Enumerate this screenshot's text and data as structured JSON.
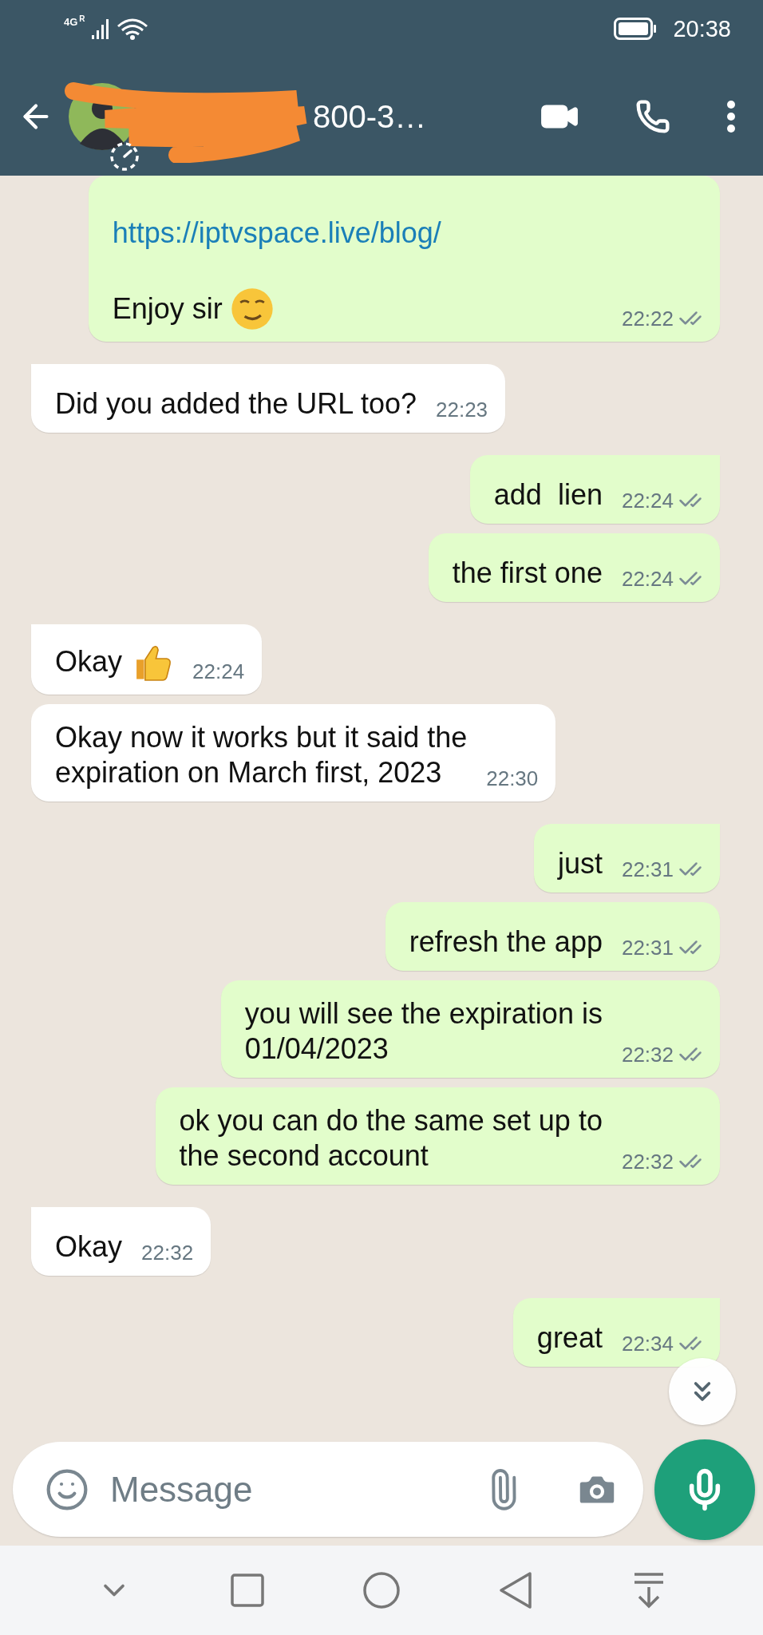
{
  "status_bar": {
    "network": "4G",
    "roaming": "R",
    "time": "20:38"
  },
  "header": {
    "contact_name": "800-3…"
  },
  "messages": [
    {
      "outgoing": true,
      "tail": false,
      "kind": "smile",
      "link": "https://iptvspace.live/blog/",
      "text": "Enjoy sir",
      "time": "22:22",
      "delivered": true
    },
    {
      "outgoing": false,
      "tail": true,
      "kind": "plain",
      "text": "Did you added the URL too?",
      "time": "22:23"
    },
    {
      "outgoing": true,
      "tail": true,
      "kind": "plain",
      "text": "add  lien",
      "time": "22:24",
      "delivered": true
    },
    {
      "outgoing": true,
      "tail": false,
      "kind": "plain",
      "text": "the first one",
      "time": "22:24",
      "delivered": true
    },
    {
      "outgoing": false,
      "tail": true,
      "kind": "thumbs",
      "text": "Okay",
      "time": "22:24"
    },
    {
      "outgoing": false,
      "tail": false,
      "kind": "plain",
      "text": "Okay now it works but it said the\nexpiration on March first, 2023",
      "time": "22:30"
    },
    {
      "outgoing": true,
      "tail": true,
      "kind": "plain",
      "text": "just",
      "time": "22:31",
      "delivered": true
    },
    {
      "outgoing": true,
      "tail": false,
      "kind": "plain",
      "text": "refresh the app",
      "time": "22:31",
      "delivered": true
    },
    {
      "outgoing": true,
      "tail": false,
      "kind": "plain",
      "text": "you will see the expiration is\n01/04/2023",
      "time": "22:32",
      "delivered": true
    },
    {
      "outgoing": true,
      "tail": false,
      "kind": "plain",
      "text": "ok you can do the same set up to\nthe second account",
      "time": "22:32",
      "delivered": true
    },
    {
      "outgoing": false,
      "tail": true,
      "kind": "plain",
      "text": "Okay",
      "time": "22:32"
    },
    {
      "outgoing": true,
      "tail": true,
      "kind": "plain",
      "text": "great",
      "time": "22:34",
      "delivered": true
    }
  ],
  "composer": {
    "placeholder": "Message"
  }
}
